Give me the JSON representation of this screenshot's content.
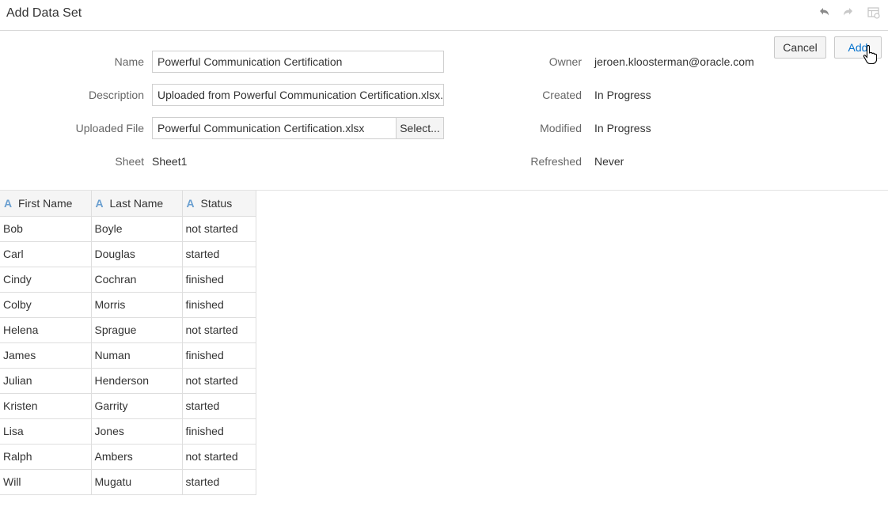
{
  "header": {
    "title": "Add Data Set",
    "icons": [
      "undo-icon",
      "redo-icon",
      "dataset-settings-icon"
    ]
  },
  "actions": {
    "cancel_label": "Cancel",
    "add_label": "Add"
  },
  "form": {
    "name_label": "Name",
    "name_value": "Powerful Communication Certification",
    "description_label": "Description",
    "description_value": "Uploaded from Powerful Communication Certification.xlsx.",
    "file_label": "Uploaded File",
    "file_value": "Powerful Communication Certification.xlsx",
    "file_select_label": "Select...",
    "sheet_label": "Sheet",
    "sheet_value": "Sheet1"
  },
  "meta": {
    "owner_label": "Owner",
    "owner_value": "jeroen.kloosterman@oracle.com",
    "created_label": "Created",
    "created_value": "In Progress",
    "modified_label": "Modified",
    "modified_value": "In Progress",
    "refreshed_label": "Refreshed",
    "refreshed_value": "Never"
  },
  "table": {
    "type_icon": "A",
    "columns": [
      "First Name",
      "Last Name",
      "Status"
    ],
    "rows": [
      [
        "Bob",
        "Boyle",
        "not started"
      ],
      [
        "Carl",
        "Douglas",
        "started"
      ],
      [
        "Cindy",
        "Cochran",
        "finished"
      ],
      [
        "Colby",
        "Morris",
        "finished"
      ],
      [
        "Helena",
        "Sprague",
        "not started"
      ],
      [
        "James",
        "Numan",
        "finished"
      ],
      [
        "Julian",
        "Henderson",
        "not started"
      ],
      [
        "Kristen",
        "Garrity",
        "started"
      ],
      [
        "Lisa",
        "Jones",
        "finished"
      ],
      [
        "Ralph",
        "Ambers",
        "not started"
      ],
      [
        "Will",
        "Mugatu",
        "started"
      ]
    ]
  },
  "colors": {
    "accent": "#0572ce",
    "type_icon": "#6a9fd0"
  }
}
